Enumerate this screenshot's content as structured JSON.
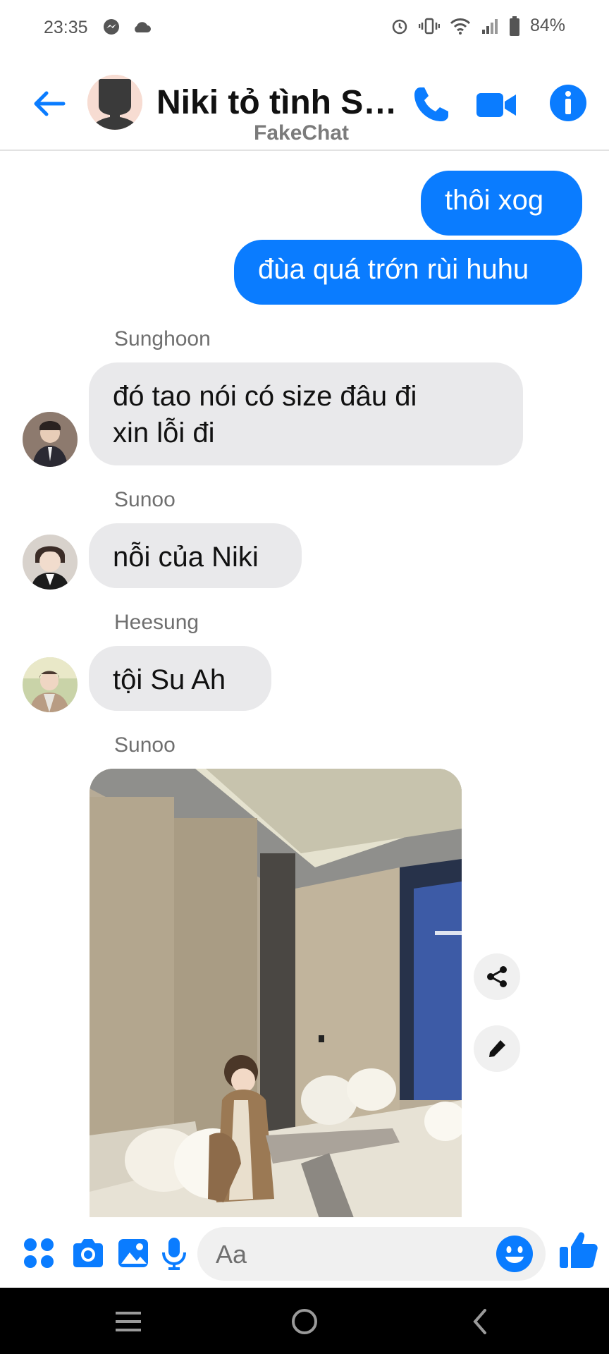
{
  "status_bar": {
    "time": "23:35",
    "battery": "84%"
  },
  "header": {
    "title": "Niki tỏ tình Su...",
    "subtitle": "FakeChat"
  },
  "messages": {
    "out1": "thôi xog",
    "out2": "đùa quá trớn rùi huhu",
    "sender1": "Sunghoon",
    "in1_line1": "đó tao nói có size đâu đi",
    "in1_line2": "xin lỗi đi",
    "sender2": "Sunoo",
    "in2": "nỗi của Niki",
    "sender3": "Heesung",
    "in3": "tội Su Ah",
    "sender4": "Sunoo"
  },
  "composer": {
    "placeholder": "Aa"
  },
  "colors": {
    "accent": "#0a7cff",
    "incoming_bubble": "#e9e9eb"
  }
}
